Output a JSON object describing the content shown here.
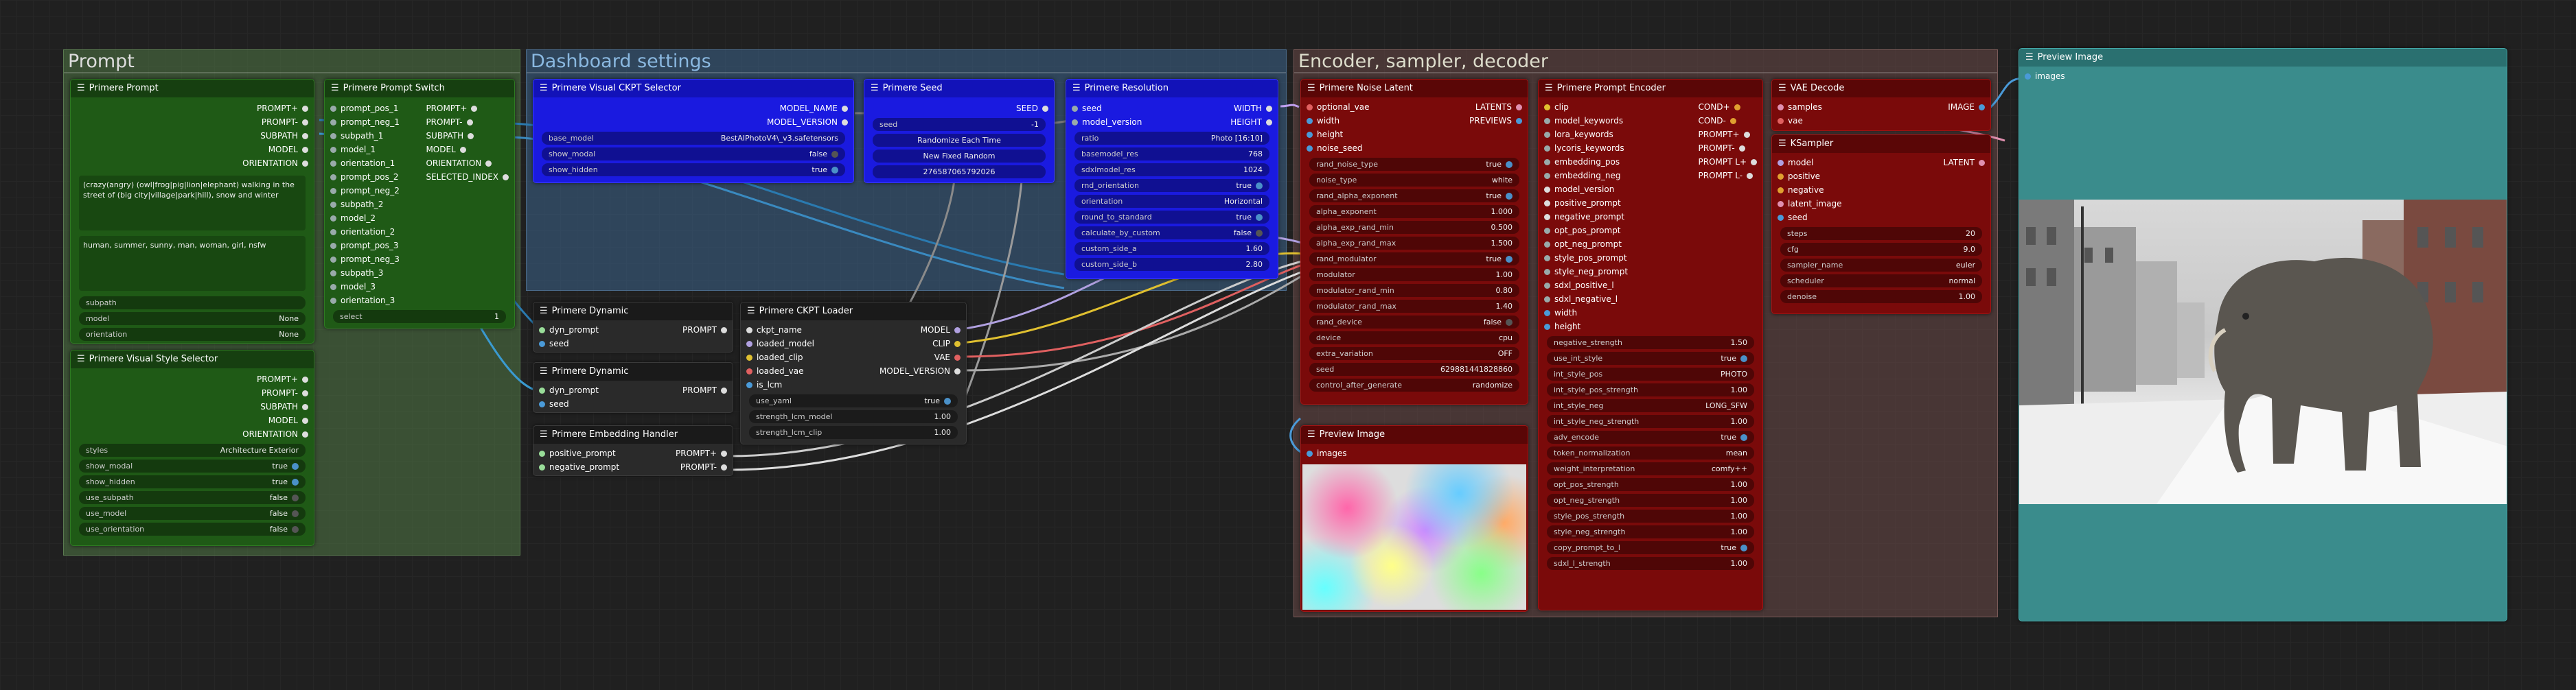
{
  "groups": {
    "prompt": {
      "title": "Prompt",
      "color": "#3f6b3a"
    },
    "dashboard": {
      "title": "Dashboard settings",
      "color": "#3a5a78"
    },
    "encoder": {
      "title": "Encoder, sampler, decoder",
      "color": "#6a4a48"
    }
  },
  "nodes": {
    "primere_prompt": {
      "title": "Primere Prompt",
      "outputs": [
        "PROMPT+",
        "PROMPT-",
        "SUBPATH",
        "MODEL",
        "ORIENTATION"
      ],
      "prompt_text": "(crazy(angry) (owl|frog|pig|lion|elephant) walking in the street of (big city|village|park|hill), snow and winter",
      "negative_text": "human, summer, sunny, man, woman, girl, nsfw",
      "widgets": [
        {
          "label": "subpath",
          "value": ""
        },
        {
          "label": "model",
          "value": "None"
        },
        {
          "label": "orientation",
          "value": "None"
        }
      ]
    },
    "prompt_switch": {
      "title": "Primere Prompt Switch",
      "inputs": [
        "prompt_pos_1",
        "prompt_neg_1",
        "subpath_1",
        "model_1",
        "orientation_1",
        "prompt_pos_2",
        "prompt_neg_2",
        "subpath_2",
        "model_2",
        "orientation_2",
        "prompt_pos_3",
        "prompt_neg_3",
        "subpath_3",
        "model_3",
        "orientation_3"
      ],
      "outputs": [
        "PROMPT+",
        "PROMPT-",
        "SUBPATH",
        "MODEL",
        "ORIENTATION",
        "SELECTED_INDEX"
      ],
      "widgets": [
        {
          "label": "select",
          "value": "1"
        }
      ]
    },
    "visual_style": {
      "title": "Primere Visual Style Selector",
      "outputs": [
        "PROMPT+",
        "PROMPT-",
        "SUBPATH",
        "MODEL",
        "ORIENTATION"
      ],
      "widgets": [
        {
          "label": "styles",
          "value": "Architecture Exterior"
        },
        {
          "label": "show_modal",
          "value": "true"
        },
        {
          "label": "show_hidden",
          "value": "true"
        },
        {
          "label": "use_subpath",
          "value": "false"
        },
        {
          "label": "use_model",
          "value": "false"
        },
        {
          "label": "use_orientation",
          "value": "false"
        }
      ]
    },
    "ckpt_selector": {
      "title": "Primere Visual CKPT Selector",
      "outputs": [
        "MODEL_NAME",
        "MODEL_VERSION"
      ],
      "widgets": [
        {
          "label": "base_model",
          "value": "BestAIPhotoV4\\_v3.safetensors"
        },
        {
          "label": "show_modal",
          "value": "false"
        },
        {
          "label": "show_hidden",
          "value": "true"
        }
      ]
    },
    "seed": {
      "title": "Primere Seed",
      "outputs": [
        "SEED"
      ],
      "widgets": [
        {
          "label": "seed",
          "value": "-1"
        }
      ],
      "buttons": [
        "Randomize Each Time",
        "New Fixed Random",
        "276587065792026"
      ]
    },
    "resolution": {
      "title": "Primere Resolution",
      "inputs": [
        "seed",
        "model_version"
      ],
      "outputs": [
        "WIDTH",
        "HEIGHT"
      ],
      "widgets": [
        {
          "label": "ratio",
          "value": "Photo [16:10]"
        },
        {
          "label": "basemodel_res",
          "value": "768"
        },
        {
          "label": "sdxlmodel_res",
          "value": "1024"
        },
        {
          "label": "rnd_orientation",
          "value": "true"
        },
        {
          "label": "orientation",
          "value": "Horizontal"
        },
        {
          "label": "round_to_standard",
          "value": "true"
        },
        {
          "label": "calculate_by_custom",
          "value": "false"
        },
        {
          "label": "custom_side_a",
          "value": "1.60"
        },
        {
          "label": "custom_side_b",
          "value": "2.80"
        }
      ]
    },
    "dynamic_1": {
      "title": "Primere Dynamic",
      "inputs": [
        "dyn_prompt",
        "seed"
      ],
      "outputs": [
        "PROMPT"
      ]
    },
    "dynamic_2": {
      "title": "Primere Dynamic",
      "inputs": [
        "dyn_prompt",
        "seed"
      ],
      "outputs": [
        "PROMPT"
      ]
    },
    "embedding": {
      "title": "Primere Embedding Handler",
      "inputs": [
        "positive_prompt",
        "negative_prompt"
      ],
      "outputs": [
        "PROMPT+",
        "PROMPT-"
      ]
    },
    "ckpt_loader": {
      "title": "Primere CKPT Loader",
      "inputs": [
        "ckpt_name",
        "loaded_model",
        "loaded_clip",
        "loaded_vae",
        "is_lcm"
      ],
      "outputs": [
        "MODEL",
        "CLIP",
        "VAE",
        "MODEL_VERSION"
      ],
      "widgets": [
        {
          "label": "use_yaml",
          "value": "true"
        },
        {
          "label": "strength_lcm_model",
          "value": "1.00"
        },
        {
          "label": "strength_lcm_clip",
          "value": "1.00"
        }
      ]
    },
    "noise_latent": {
      "title": "Primere Noise Latent",
      "inputs": [
        "optional_vae",
        "width",
        "height",
        "noise_seed"
      ],
      "outputs": [
        "LATENTS",
        "PREVIEWS"
      ],
      "widgets": [
        {
          "label": "rand_noise_type",
          "value": "true"
        },
        {
          "label": "noise_type",
          "value": "white"
        },
        {
          "label": "rand_alpha_exponent",
          "value": "true"
        },
        {
          "label": "alpha_exponent",
          "value": "1.000"
        },
        {
          "label": "alpha_exp_rand_min",
          "value": "0.500"
        },
        {
          "label": "alpha_exp_rand_max",
          "value": "1.500"
        },
        {
          "label": "rand_modulator",
          "value": "true"
        },
        {
          "label": "modulator",
          "value": "1.00"
        },
        {
          "label": "modulator_rand_min",
          "value": "0.80"
        },
        {
          "label": "modulator_rand_max",
          "value": "1.40"
        },
        {
          "label": "rand_device",
          "value": "false"
        },
        {
          "label": "device",
          "value": "cpu"
        },
        {
          "label": "extra_variation",
          "value": "OFF"
        },
        {
          "label": "seed",
          "value": "629881441828860"
        },
        {
          "label": "control_after_generate",
          "value": "randomize"
        }
      ]
    },
    "prompt_encoder": {
      "title": "Primere Prompt Encoder",
      "inputs": [
        "clip",
        "model_keywords",
        "lora_keywords",
        "lycoris_keywords",
        "embedding_pos",
        "embedding_neg",
        "model_version",
        "positive_prompt",
        "negative_prompt",
        "opt_pos_prompt",
        "opt_neg_prompt",
        "style_pos_prompt",
        "style_neg_prompt",
        "sdxl_positive_l",
        "sdxl_negative_l",
        "width",
        "height"
      ],
      "outputs": [
        "COND+",
        "COND-",
        "PROMPT+",
        "PROMPT-",
        "PROMPT L+",
        "PROMPT L-"
      ],
      "widgets": [
        {
          "label": "negative_strength",
          "value": "1.50"
        },
        {
          "label": "use_int_style",
          "value": "true"
        },
        {
          "label": "int_style_pos",
          "value": "PHOTO"
        },
        {
          "label": "int_style_pos_strength",
          "value": "1.00"
        },
        {
          "label": "int_style_neg",
          "value": "LONG_SFW"
        },
        {
          "label": "int_style_neg_strength",
          "value": "1.00"
        },
        {
          "label": "adv_encode",
          "value": "true"
        },
        {
          "label": "token_normalization",
          "value": "mean"
        },
        {
          "label": "weight_interpretation",
          "value": "comfy++"
        },
        {
          "label": "opt_pos_strength",
          "value": "1.00"
        },
        {
          "label": "opt_neg_strength",
          "value": "1.00"
        },
        {
          "label": "style_pos_strength",
          "value": "1.00"
        },
        {
          "label": "style_neg_strength",
          "value": "1.00"
        },
        {
          "label": "copy_prompt_to_l",
          "value": "true"
        },
        {
          "label": "sdxl_l_strength",
          "value": "1.00"
        }
      ]
    },
    "vae_decode": {
      "title": "VAE Decode",
      "inputs": [
        "samples",
        "vae"
      ],
      "outputs": [
        "IMAGE"
      ]
    },
    "ksampler": {
      "title": "KSampler",
      "inputs": [
        "model",
        "positive",
        "negative",
        "latent_image",
        "seed"
      ],
      "outputs": [
        "LATENT"
      ],
      "widgets": [
        {
          "label": "steps",
          "value": "20"
        },
        {
          "label": "cfg",
          "value": "9.0"
        },
        {
          "label": "sampler_name",
          "value": "euler"
        },
        {
          "label": "scheduler",
          "value": "normal"
        },
        {
          "label": "denoise",
          "value": "1.00"
        }
      ]
    },
    "preview_small": {
      "title": "Preview Image",
      "inputs": [
        "images"
      ]
    },
    "preview_large": {
      "title": "Preview Image",
      "inputs": [
        "images"
      ]
    }
  },
  "colors": {
    "green_node": "#1f5a16",
    "blue_node": "#1a1ae0",
    "red_node": "#7a0a0a",
    "dark_node": "#2a2a2a",
    "teal_node": "#3a8c8c"
  }
}
